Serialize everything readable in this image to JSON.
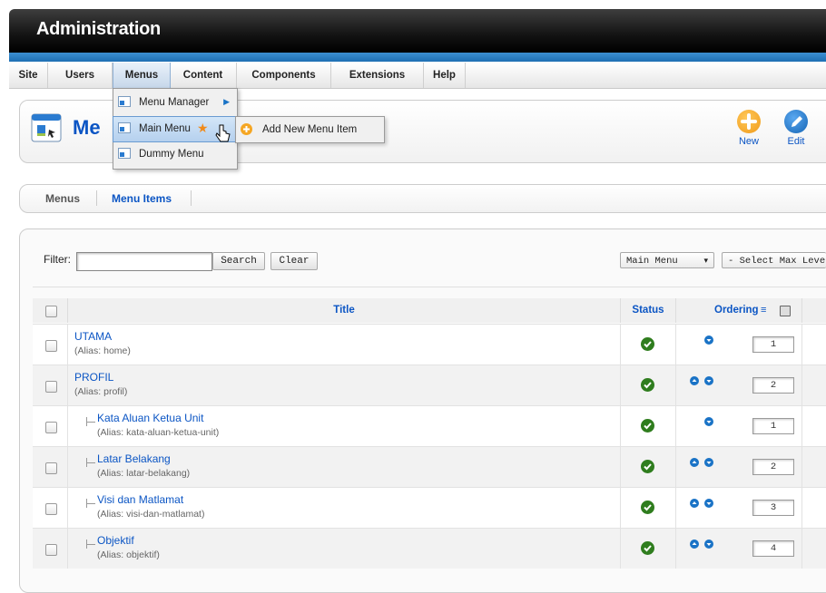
{
  "header": {
    "title": "Administration"
  },
  "menubar": {
    "items": [
      {
        "label": "Site"
      },
      {
        "label": "Users"
      },
      {
        "label": "Menus"
      },
      {
        "label": "Content"
      },
      {
        "label": "Components"
      },
      {
        "label": "Extensions"
      },
      {
        "label": "Help"
      }
    ]
  },
  "dropdown": {
    "items": [
      {
        "label": "Menu Manager"
      },
      {
        "label": "Main Menu"
      },
      {
        "label": "Dummy Menu"
      }
    ],
    "flyout": {
      "label": "Add New Menu Item"
    }
  },
  "toolbar": {
    "page_title_fragment": "Me",
    "new_label": "New",
    "edit_label": "Edit",
    "new_color": "#f5a623",
    "edit_color": "#1a73c6"
  },
  "submenu": {
    "tabs": [
      {
        "label": "Menus"
      },
      {
        "label": "Menu Items"
      }
    ]
  },
  "filter": {
    "label": "Filter:",
    "value": "",
    "search_label": "Search",
    "clear_label": "Clear",
    "menu_select": "Main Menu",
    "levels_select": "- Select Max Levels -"
  },
  "table": {
    "headers": {
      "title": "Title",
      "status": "Status",
      "ordering": "Ordering"
    },
    "alias_prefix": "Alias",
    "rows": [
      {
        "title": "UTAMA",
        "alias": "home",
        "level": 1,
        "up": false,
        "down": true,
        "order": "1"
      },
      {
        "title": "PROFIL",
        "alias": "profil",
        "level": 1,
        "up": true,
        "down": true,
        "order": "2"
      },
      {
        "title": "Kata Aluan Ketua Unit",
        "alias": "kata-aluan-ketua-unit",
        "level": 2,
        "up": false,
        "down": true,
        "order": "1"
      },
      {
        "title": "Latar Belakang",
        "alias": "latar-belakang",
        "level": 2,
        "up": true,
        "down": true,
        "order": "2"
      },
      {
        "title": "Visi dan Matlamat",
        "alias": "visi-dan-matlamat",
        "level": 2,
        "up": true,
        "down": true,
        "order": "3"
      },
      {
        "title": "Objektif",
        "alias": "objektif",
        "level": 2,
        "up": true,
        "down": true,
        "order": "4"
      }
    ]
  },
  "colors": {
    "link": "#0b55c4",
    "status_green": "#2f7d1e",
    "header_blue": "#1e6fb3"
  }
}
